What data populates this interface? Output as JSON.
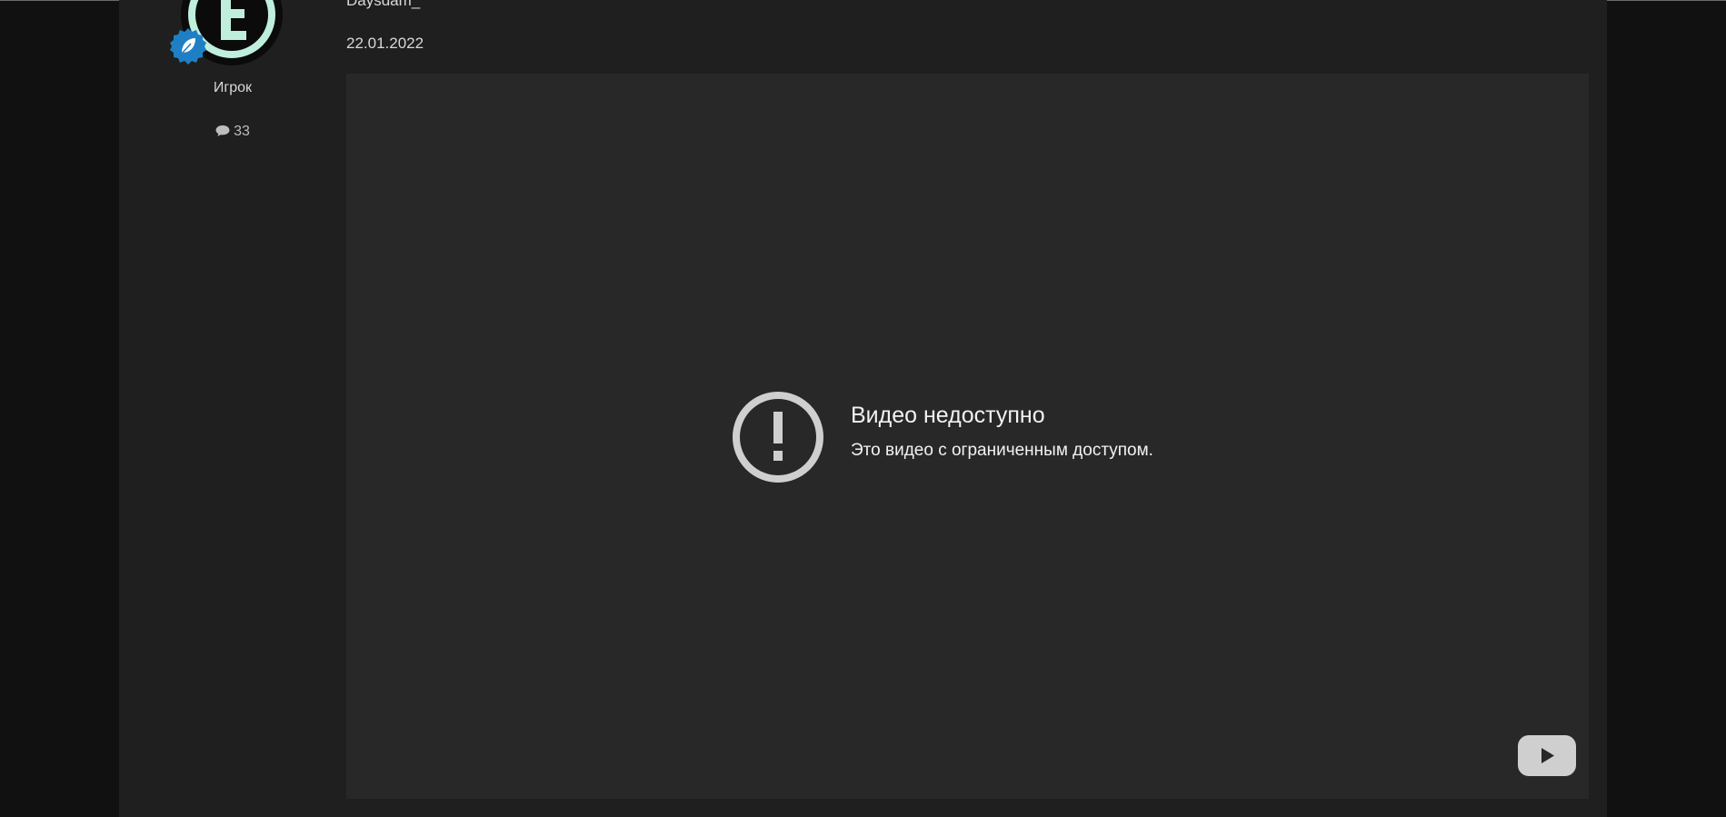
{
  "post": {
    "author": "Daysdam_",
    "date": "22.01.2022"
  },
  "user": {
    "role": "Игрок",
    "message_count": "33",
    "avatar_icon": "letter-e-logo-icon",
    "badge_icon": "leaf-badge-icon"
  },
  "video": {
    "status_icon": "exclamation-circle-icon",
    "title": "Видео недоступно",
    "subtitle": "Это видео с ограниченным доступом.",
    "logo_icon": "youtube-logo-icon"
  },
  "colors": {
    "page_bg": "#111111",
    "content_bg": "#1f1f1f",
    "video_bg": "#282828",
    "badge_blue": "#1f7fc4",
    "avatar_accent": "#bfeedd"
  }
}
